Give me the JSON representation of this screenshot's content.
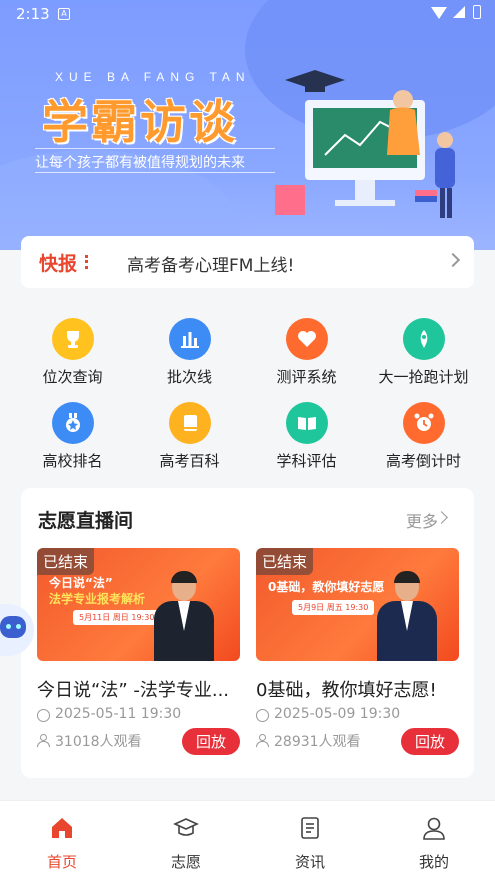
{
  "status_bar": {
    "time": "2:13"
  },
  "banner": {
    "pinyin": "XUE BA FANG TAN",
    "title": "学霸访谈",
    "slogan": "让每个孩子都有被值得规划的未来"
  },
  "news": {
    "tag": "快报",
    "text": "高考备考心理FM上线!"
  },
  "grid": [
    {
      "label": "位次查询",
      "icon": "trophy-icon",
      "color": "#ffc21f"
    },
    {
      "label": "批次线",
      "icon": "bar-chart-icon",
      "color": "#3d8cf5"
    },
    {
      "label": "测评系统",
      "icon": "heart-icon",
      "color": "#ff6b2e"
    },
    {
      "label": "大一抢跑计划",
      "icon": "rocket-icon",
      "color": "#1fc59b"
    },
    {
      "label": "高校排名",
      "icon": "medal-icon",
      "color": "#3d8cf5"
    },
    {
      "label": "高考百科",
      "icon": "book-icon",
      "color": "#ffb21f"
    },
    {
      "label": "学科评估",
      "icon": "open-book-icon",
      "color": "#1fc59b"
    },
    {
      "label": "高考倒计时",
      "icon": "alarm-clock-icon",
      "color": "#ff6b2e"
    }
  ],
  "live": {
    "heading": "志愿直播间",
    "more": "更多",
    "cards": [
      {
        "badge": "已结束",
        "thumb_line1": "今日说“法”",
        "thumb_line2": "法学专业报考解析",
        "thumb_date": "5月11日 周日 19:30",
        "title": "今日说“法” -法学专业...",
        "time": "2025-05-11 19:30",
        "views": "31018人观看",
        "action": "回放"
      },
      {
        "badge": "已结束",
        "thumb_line1": "0基础，教你填好志愿",
        "thumb_line2": "",
        "thumb_date": "5月9日 周五 19:30",
        "title": "0基础，教你填好志愿!",
        "time": "2025-05-09 19:30",
        "views": "28931人观看",
        "action": "回放"
      }
    ]
  },
  "nav": [
    {
      "label": "首页",
      "icon": "home-icon",
      "active": true
    },
    {
      "label": "志愿",
      "icon": "graduation-cap-icon",
      "active": false
    },
    {
      "label": "资讯",
      "icon": "news-icon",
      "active": false
    },
    {
      "label": "我的",
      "icon": "user-icon",
      "active": false
    }
  ],
  "colors": {
    "accent": "#e8462e",
    "replay": "#e8303a",
    "banner": "#7d9cff"
  }
}
